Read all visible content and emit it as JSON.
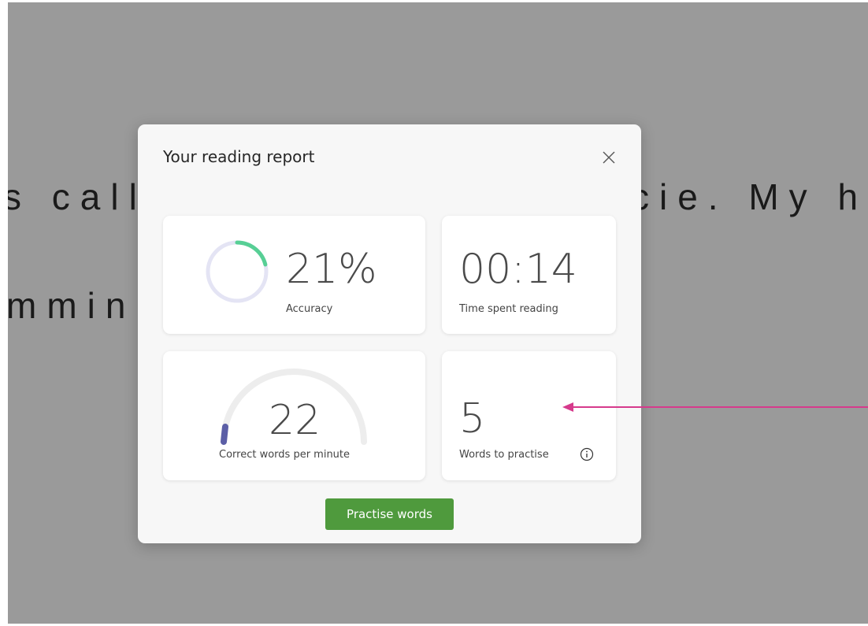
{
  "background_text": {
    "line1_left": "s call",
    "line1_right": "cie. My h",
    "line2_left": "mmin"
  },
  "dialog": {
    "title": "Your reading report",
    "close_icon": "close-icon",
    "accuracy": {
      "value": "21%",
      "label": "Accuracy",
      "progress_fraction": 0.21,
      "ring_track_color": "#e4e4f4",
      "ring_fill_color": "#57cf95"
    },
    "time": {
      "value": "00:14",
      "label": "Time spent reading"
    },
    "wpm": {
      "value": "22",
      "label": "Correct words per minute",
      "gauge_track_color": "#ededed",
      "gauge_fill_color": "#5b5ea6"
    },
    "words": {
      "value": "5",
      "label": "Words to practise",
      "info_icon": "info-icon"
    },
    "practise_button": "Practise words"
  },
  "colors": {
    "overlay": "#9a9a9a",
    "accent_button": "#4f9a3d",
    "annotation_arrow": "#d63a8c"
  }
}
